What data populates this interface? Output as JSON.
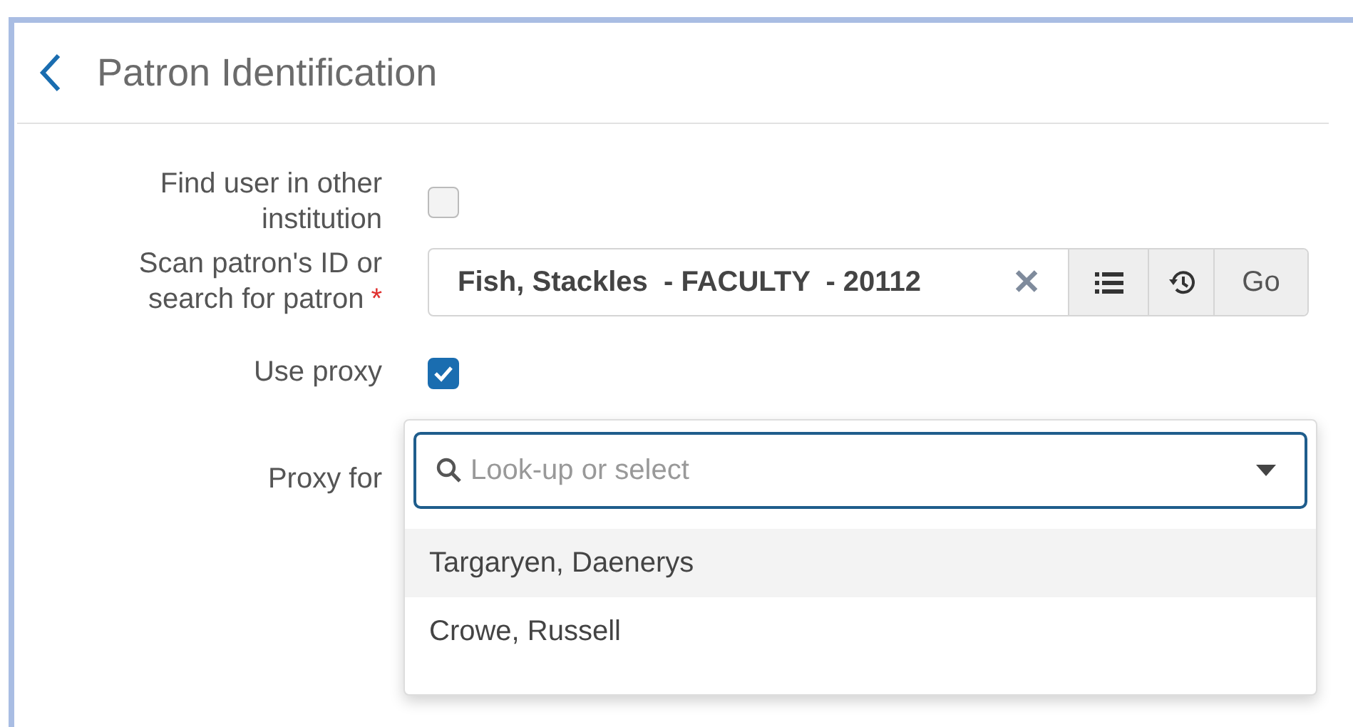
{
  "header": {
    "title": "Patron Identification"
  },
  "form": {
    "other_institution": {
      "label": "Find user in other institution",
      "checked": false
    },
    "patron": {
      "label": "Scan patron's ID or search for patron",
      "required_mark": "*",
      "value": "Fish, Stackles  - FACULTY  - 20112",
      "clear": "✕",
      "go": "Go"
    },
    "use_proxy": {
      "label": "Use proxy",
      "checked": true
    },
    "proxy_for": {
      "label": "Proxy for",
      "placeholder": "Look-up or select",
      "options": [
        {
          "label": "Targaryen, Daenerys",
          "selected": true
        },
        {
          "label": "Crowe, Russell",
          "selected": false
        }
      ]
    }
  }
}
